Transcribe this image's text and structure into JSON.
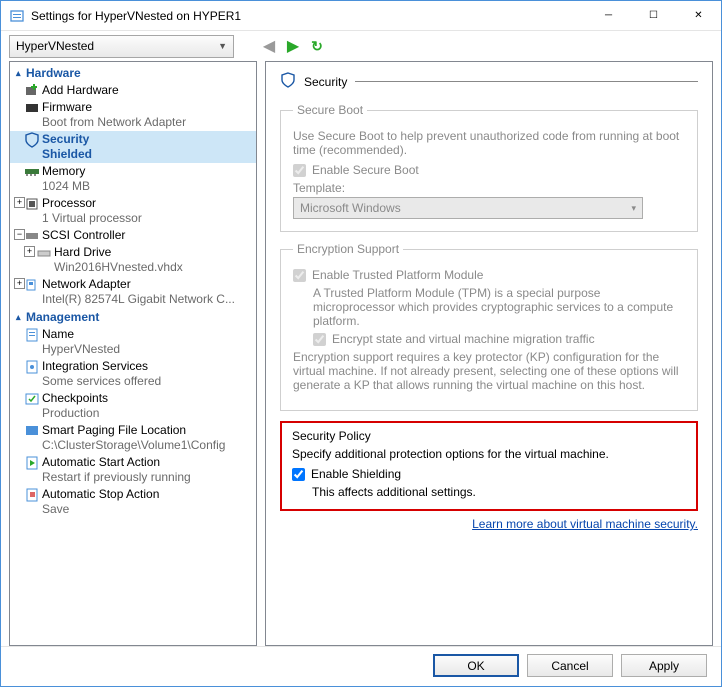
{
  "window": {
    "title": "Settings for HyperVNested on HYPER1"
  },
  "toolbar": {
    "vm_selected": "HyperVNested"
  },
  "sidebar": {
    "sections": [
      {
        "title": "Hardware",
        "items": [
          {
            "label": "Add Hardware",
            "sub": ""
          },
          {
            "label": "Firmware",
            "sub": "Boot from Network Adapter"
          },
          {
            "label": "Security",
            "sub": "Shielded",
            "selected": true
          },
          {
            "label": "Memory",
            "sub": "1024 MB"
          },
          {
            "label": "Processor",
            "sub": "1 Virtual processor",
            "expand": true
          },
          {
            "label": "SCSI Controller",
            "sub": "",
            "expand": true,
            "open": true
          },
          {
            "label": "Hard Drive",
            "sub": "Win2016HVnested.vhdx",
            "indent": true,
            "expand": true
          },
          {
            "label": "Network Adapter",
            "sub": "Intel(R) 82574L Gigabit Network C...",
            "expand": true
          }
        ]
      },
      {
        "title": "Management",
        "items": [
          {
            "label": "Name",
            "sub": "HyperVNested"
          },
          {
            "label": "Integration Services",
            "sub": "Some services offered"
          },
          {
            "label": "Checkpoints",
            "sub": "Production"
          },
          {
            "label": "Smart Paging File Location",
            "sub": "C:\\ClusterStorage\\Volume1\\Config"
          },
          {
            "label": "Automatic Start Action",
            "sub": "Restart if previously running"
          },
          {
            "label": "Automatic Stop Action",
            "sub": "Save"
          }
        ]
      }
    ]
  },
  "main": {
    "title": "Security",
    "secure_boot": {
      "legend": "Secure Boot",
      "desc": "Use Secure Boot to help prevent unauthorized code from running at boot time (recommended).",
      "enable_label": "Enable Secure Boot",
      "template_label": "Template:",
      "template_value": "Microsoft Windows"
    },
    "encryption": {
      "legend": "Encryption Support",
      "tpm_label": "Enable Trusted Platform Module",
      "tpm_desc": "A Trusted Platform Module (TPM) is a special purpose microprocessor which provides cryptographic services to a compute platform.",
      "encrypt_label": "Encrypt state and virtual machine migration traffic",
      "kp_desc": "Encryption support requires a key protector (KP) configuration for the virtual machine. If not already present, selecting one of these options will generate a KP that allows running the virtual machine on this host."
    },
    "policy": {
      "legend": "Security Policy",
      "desc": "Specify additional protection options for the virtual machine.",
      "shield_label": "Enable Shielding",
      "shield_note": "This affects additional settings."
    },
    "link": "Learn more about virtual machine security."
  },
  "buttons": {
    "ok": "OK",
    "cancel": "Cancel",
    "apply": "Apply"
  }
}
